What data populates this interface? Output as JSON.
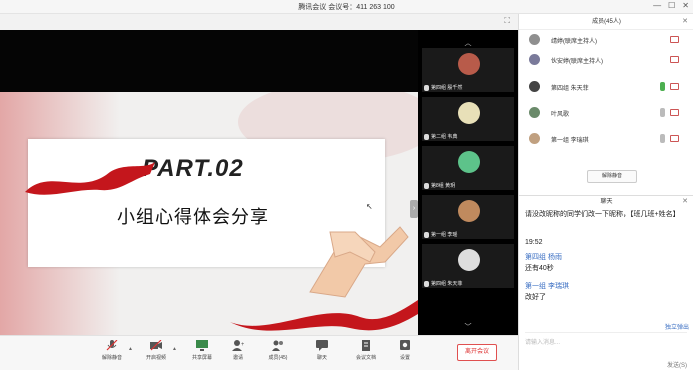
{
  "window": {
    "title": "腾讯会议 会议号：411 263 100"
  },
  "slide": {
    "part": "PART.02",
    "subtitle": "小组心得体会分享"
  },
  "thumbnails": [
    {
      "label": "第四组 殷千然",
      "avatar_color": "#b85b4a"
    },
    {
      "label": "第二组 韦典",
      "avatar_color": "#e8e0b8"
    },
    {
      "label": "第8组 黄玥",
      "avatar_color": "#5dc38a"
    },
    {
      "label": "第一组 李瑶",
      "avatar_color": "#c08a5e"
    },
    {
      "label": "第四组 朱天菲",
      "avatar_color": "#dddddd"
    }
  ],
  "toolbar": {
    "items": [
      {
        "label": "解除静音",
        "icon": "mic-muted-icon"
      },
      {
        "label": "开启视频",
        "icon": "camera-off-icon"
      },
      {
        "label": "共享屏幕",
        "icon": "screen-share-icon"
      },
      {
        "label": "邀请",
        "icon": "invite-icon"
      },
      {
        "label": "成员(45)",
        "icon": "members-icon"
      },
      {
        "label": "聊天",
        "icon": "chat-icon"
      },
      {
        "label": "会议文档",
        "icon": "document-icon"
      },
      {
        "label": "设置",
        "icon": "settings-icon"
      }
    ],
    "end_label": "离开会议"
  },
  "members": {
    "title": "成员(45人)",
    "list": [
      {
        "name": "靖婷(联席主持人)",
        "color": "#8f8f8f"
      },
      {
        "name": "伙安婷(联席主持人)",
        "color": "#7a7a9a"
      },
      {
        "name": "第四组 朱天菲",
        "color": "#444444"
      },
      {
        "name": "叶风歌",
        "color": "#6a8a6a"
      },
      {
        "name": "第一组 李瑞琪",
        "color": "#c0a080"
      }
    ],
    "mute_all": "解除静音"
  },
  "chat": {
    "title": "聊天",
    "messages": [
      {
        "text": "请没改昵称的同学们改一下昵称，【班几班+姓名】"
      },
      {
        "time": "19:52"
      },
      {
        "sender": "第四组 杨雨",
        "text": "还有40秒"
      },
      {
        "sender": "第一组 李瑞琪",
        "text": "改好了"
      }
    ],
    "input_placeholder": "请输入消息...",
    "link": "独立弹出",
    "send": "发送(S)"
  }
}
